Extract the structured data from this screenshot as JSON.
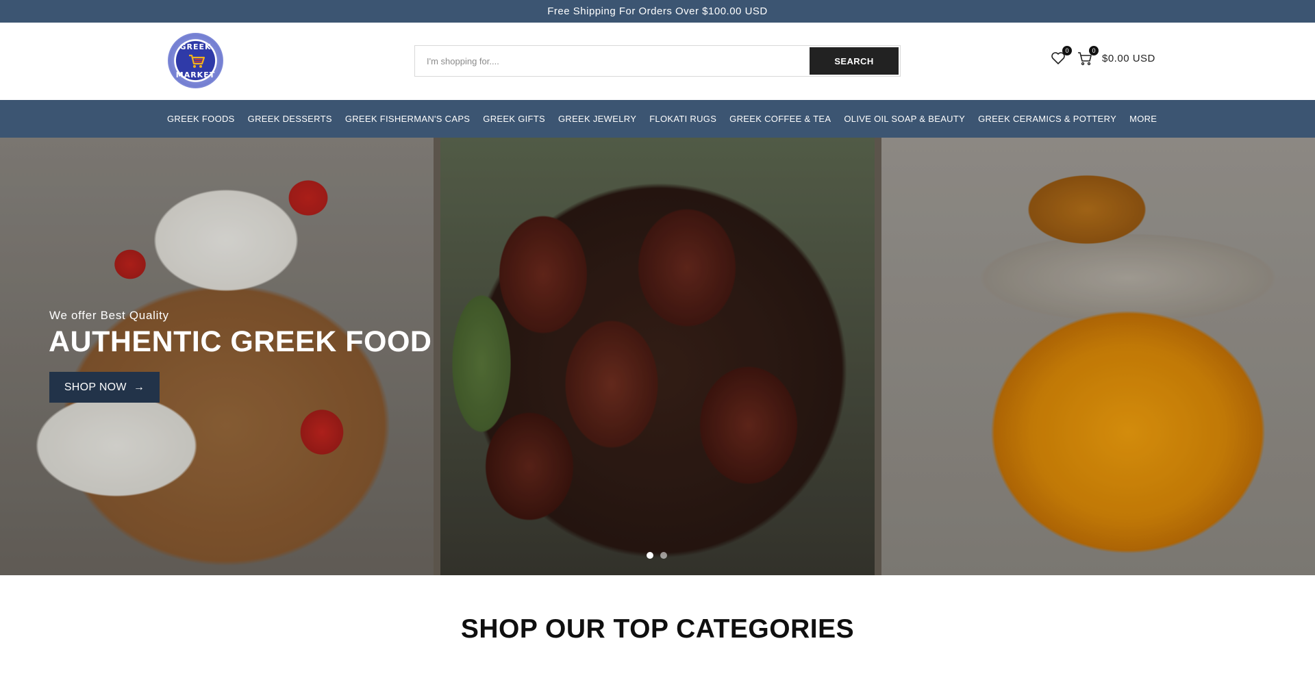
{
  "announcement": {
    "text": "Free Shipping For Orders Over $100.00 USD"
  },
  "header": {
    "logo": {
      "top_text": "GREEK",
      "bottom_text": "MARKET"
    },
    "search": {
      "placeholder": "I'm shopping for....",
      "value": "",
      "button_label": "SEARCH"
    },
    "wishlist": {
      "icon": "heart-icon",
      "count": "0"
    },
    "cart": {
      "icon": "cart-icon",
      "count": "0",
      "total": "$0.00 USD"
    }
  },
  "nav": {
    "items": [
      {
        "label": "GREEK FOODS"
      },
      {
        "label": "GREEK DESSERTS"
      },
      {
        "label": "GREEK FISHERMAN'S CAPS"
      },
      {
        "label": "GREEK GIFTS"
      },
      {
        "label": "GREEK JEWELRY"
      },
      {
        "label": "FLOKATI RUGS"
      },
      {
        "label": "GREEK COFFEE & TEA"
      },
      {
        "label": "OLIVE OIL SOAP & BEAUTY"
      },
      {
        "label": "GREEK CERAMICS & POTTERY"
      },
      {
        "label": "MORE"
      }
    ]
  },
  "hero": {
    "subtitle": "We offer Best Quality",
    "title": "AUTHENTIC GREEK FOOD",
    "button_label": "SHOP NOW",
    "button_icon": "arrow-right-icon",
    "slides": {
      "count": 2,
      "active": 1
    }
  },
  "sections": {
    "top_categories_title": "SHOP OUR TOP CATEGORIES"
  },
  "colors": {
    "brand_blue": "#3c5572",
    "button_dark": "#222222",
    "hero_button": "#223349"
  }
}
